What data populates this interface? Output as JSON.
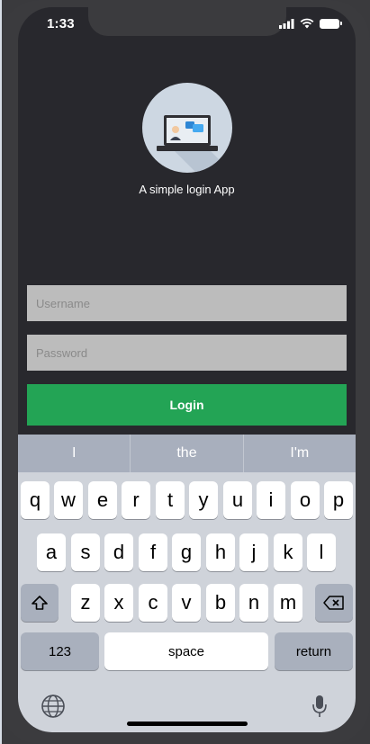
{
  "status_bar": {
    "time": "1:33"
  },
  "app": {
    "subtitle": "A simple login App",
    "username_placeholder": "Username",
    "password_placeholder": "Password",
    "login_label": "Login",
    "colors": {
      "background": "#28282d",
      "login_button": "#23a455",
      "field": "#bcbcbc"
    }
  },
  "keyboard": {
    "suggestions": [
      "I",
      "the",
      "I'm"
    ],
    "row1": [
      "q",
      "w",
      "e",
      "r",
      "t",
      "y",
      "u",
      "i",
      "o",
      "p"
    ],
    "row2": [
      "a",
      "s",
      "d",
      "f",
      "g",
      "h",
      "j",
      "k",
      "l"
    ],
    "row3": [
      "z",
      "x",
      "c",
      "v",
      "b",
      "n",
      "m"
    ],
    "numbers_label": "123",
    "space_label": "space",
    "return_label": "return"
  }
}
